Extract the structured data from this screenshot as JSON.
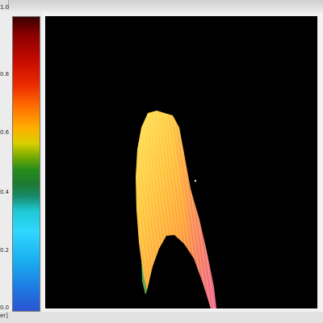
{
  "window": {
    "colorbar": {
      "ticks": [
        "1.0",
        "0.8",
        "0.6",
        "0.4",
        "0.2",
        "0.0"
      ]
    },
    "unit_label": "er]"
  }
}
